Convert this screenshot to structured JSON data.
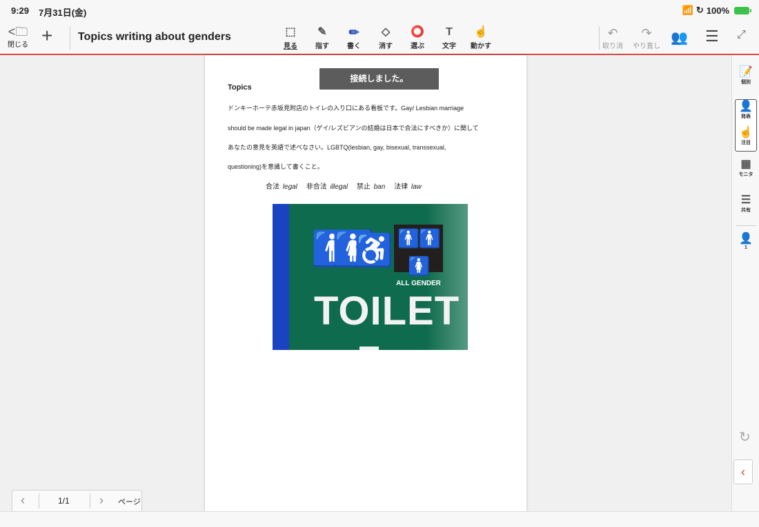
{
  "status_bar": {
    "time": "9:29",
    "date": "7月31日(金)",
    "wifi_icon": "wifi-icon",
    "rotation_lock_icon": "rotation-lock-icon",
    "battery": "100%",
    "battery_color": "#3cc24a"
  },
  "toolbar": {
    "close_label": "閉じる",
    "title": "Topics writing about genders",
    "tools": [
      {
        "label": "見る",
        "icon": "view-icon"
      },
      {
        "label": "指す",
        "icon": "pointer-icon"
      },
      {
        "label": "書く",
        "icon": "pen-icon"
      },
      {
        "label": "消す",
        "icon": "eraser-icon"
      },
      {
        "label": "選ぶ",
        "icon": "select-icon"
      },
      {
        "label": "文字",
        "icon": "text-icon"
      },
      {
        "label": "動かす",
        "icon": "move-icon"
      }
    ],
    "undo_label": "取り消し",
    "redo_label": "やり直し",
    "accent_color": "#d64545"
  },
  "document": {
    "toast": "接続しました。",
    "title": "Topics",
    "lines": [
      "ドンキーホーテ赤坂見附店のトイレの入り口にある看板です。Gay/ Lesbian marriage",
      "should be made legal in japan（ゲイ/レズビアンの結婚は日本で合法にすべきか）に関して",
      "あなたの意見を英語で述べなさい。LGBTQ(lesbian, gay, bisexual, transsexual,",
      "questioning)を意識して書くこと。"
    ],
    "vocab": [
      {
        "jp": "合法",
        "en": "legal"
      },
      {
        "jp": "非合法",
        "en": "illegal"
      },
      {
        "jp": "禁止",
        "en": "ban"
      },
      {
        "jp": "法律",
        "en": "law"
      }
    ],
    "image": {
      "sign_text": "TOILET",
      "badge_text": "ALL GENDER"
    }
  },
  "pager": {
    "current": "1/1",
    "label": "ページ"
  },
  "right_panel": {
    "individual": "個別",
    "present": "発表",
    "focus": "注目",
    "monitor": "モニタ",
    "share": "共有",
    "user_count": "1"
  }
}
